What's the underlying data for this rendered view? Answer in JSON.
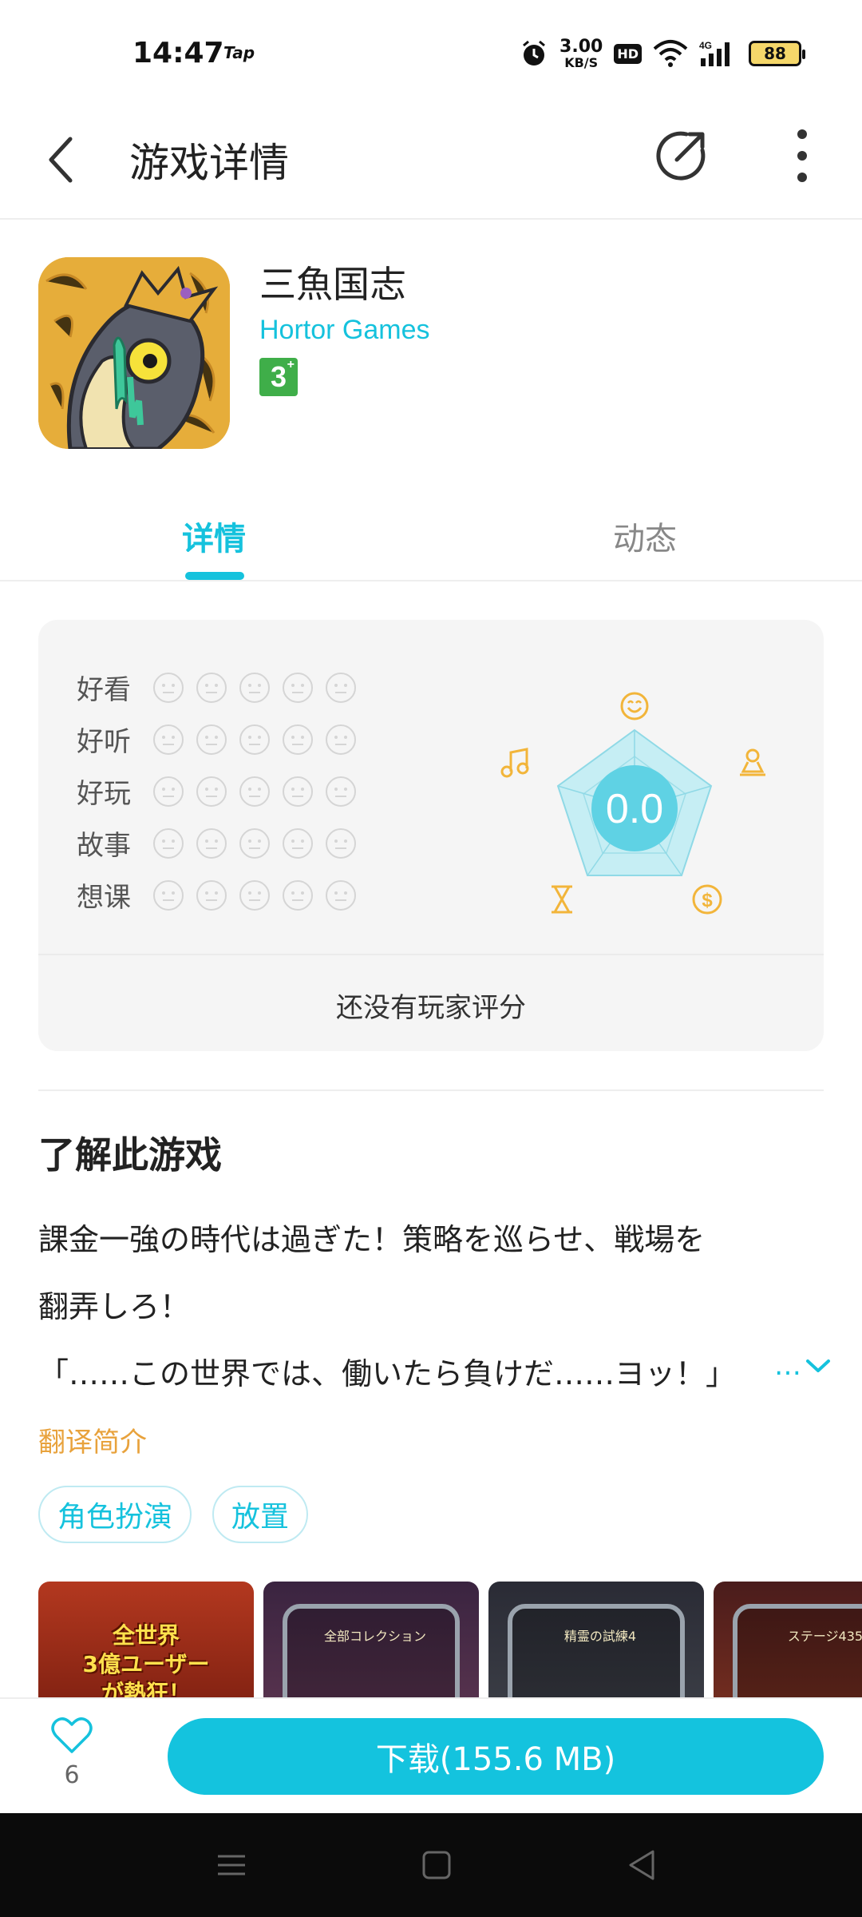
{
  "status_bar": {
    "time": "14:47",
    "tap_label": "Tap",
    "net_speed_value": "3.00",
    "net_speed_unit": "KB/S",
    "hd_label": "HD",
    "network_type": "4G",
    "battery_level": "88"
  },
  "header": {
    "title": "游戏详情"
  },
  "app": {
    "name": "三魚国志",
    "developer": "Hortor Games",
    "age_rating": "3"
  },
  "tabs": [
    {
      "label": "详情",
      "active": true
    },
    {
      "label": "动态",
      "active": false
    }
  ],
  "rating": {
    "categories": [
      {
        "label": "好看",
        "faces": 5
      },
      {
        "label": "好听",
        "faces": 5
      },
      {
        "label": "好玩",
        "faces": 5
      },
      {
        "label": "故事",
        "faces": 5
      },
      {
        "label": "想课",
        "faces": 5
      }
    ],
    "score": "0.0",
    "radar_icons": [
      "smile-icon",
      "person-icon",
      "dollar-icon",
      "hourglass-icon",
      "music-icon"
    ],
    "empty_text": "还没有玩家评分"
  },
  "about": {
    "title": "了解此游戏",
    "lines": [
      "課金一強の時代は過ぎた！策略を巡らせ、戦場を",
      "翻弄しろ！",
      "「……この世界では、働いたら負けだ……ヨッ！」"
    ],
    "expand_label": "…",
    "translate_label": "翻译简介"
  },
  "tags": [
    "角色扮演",
    "放置"
  ],
  "screenshots": [
    {
      "caption": "全世界\n3億ユーザー\nが熱狂！"
    },
    {
      "caption": "全部コレクション"
    },
    {
      "caption": "精霊の試練4"
    },
    {
      "caption": "ステージ435"
    }
  ],
  "bottom_bar": {
    "like_count": "6",
    "download_label": "下载(155.6 MB)"
  },
  "colors": {
    "accent": "#15c2dd",
    "download_button": "#14c3de",
    "translate_link": "#e8a23c",
    "age_badge": "#3fae49",
    "radar_icon": "#f2b53a"
  }
}
